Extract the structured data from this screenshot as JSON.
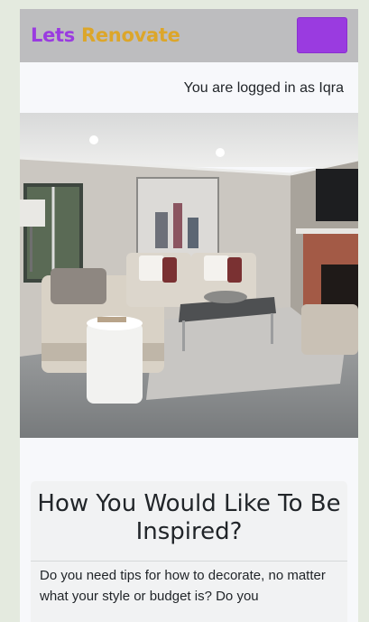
{
  "brand": {
    "word1": "Lets",
    "word2": "Renovate"
  },
  "navbar": {
    "toggle_icon": "menu-toggle-icon",
    "toggle_color": "#9a3be0"
  },
  "user": {
    "login_status": "You are logged in as Iqra"
  },
  "hero": {
    "image": "living-room-photo"
  },
  "section": {
    "title": "How You Would Like To Be Inspired?",
    "body": "Do you need tips for how to decorate, no matter what your style or budget is? Do you"
  },
  "colors": {
    "brand_purple": "#9a3be0",
    "brand_gold": "#dca62a",
    "navbar_bg": "#bdbdbf"
  }
}
